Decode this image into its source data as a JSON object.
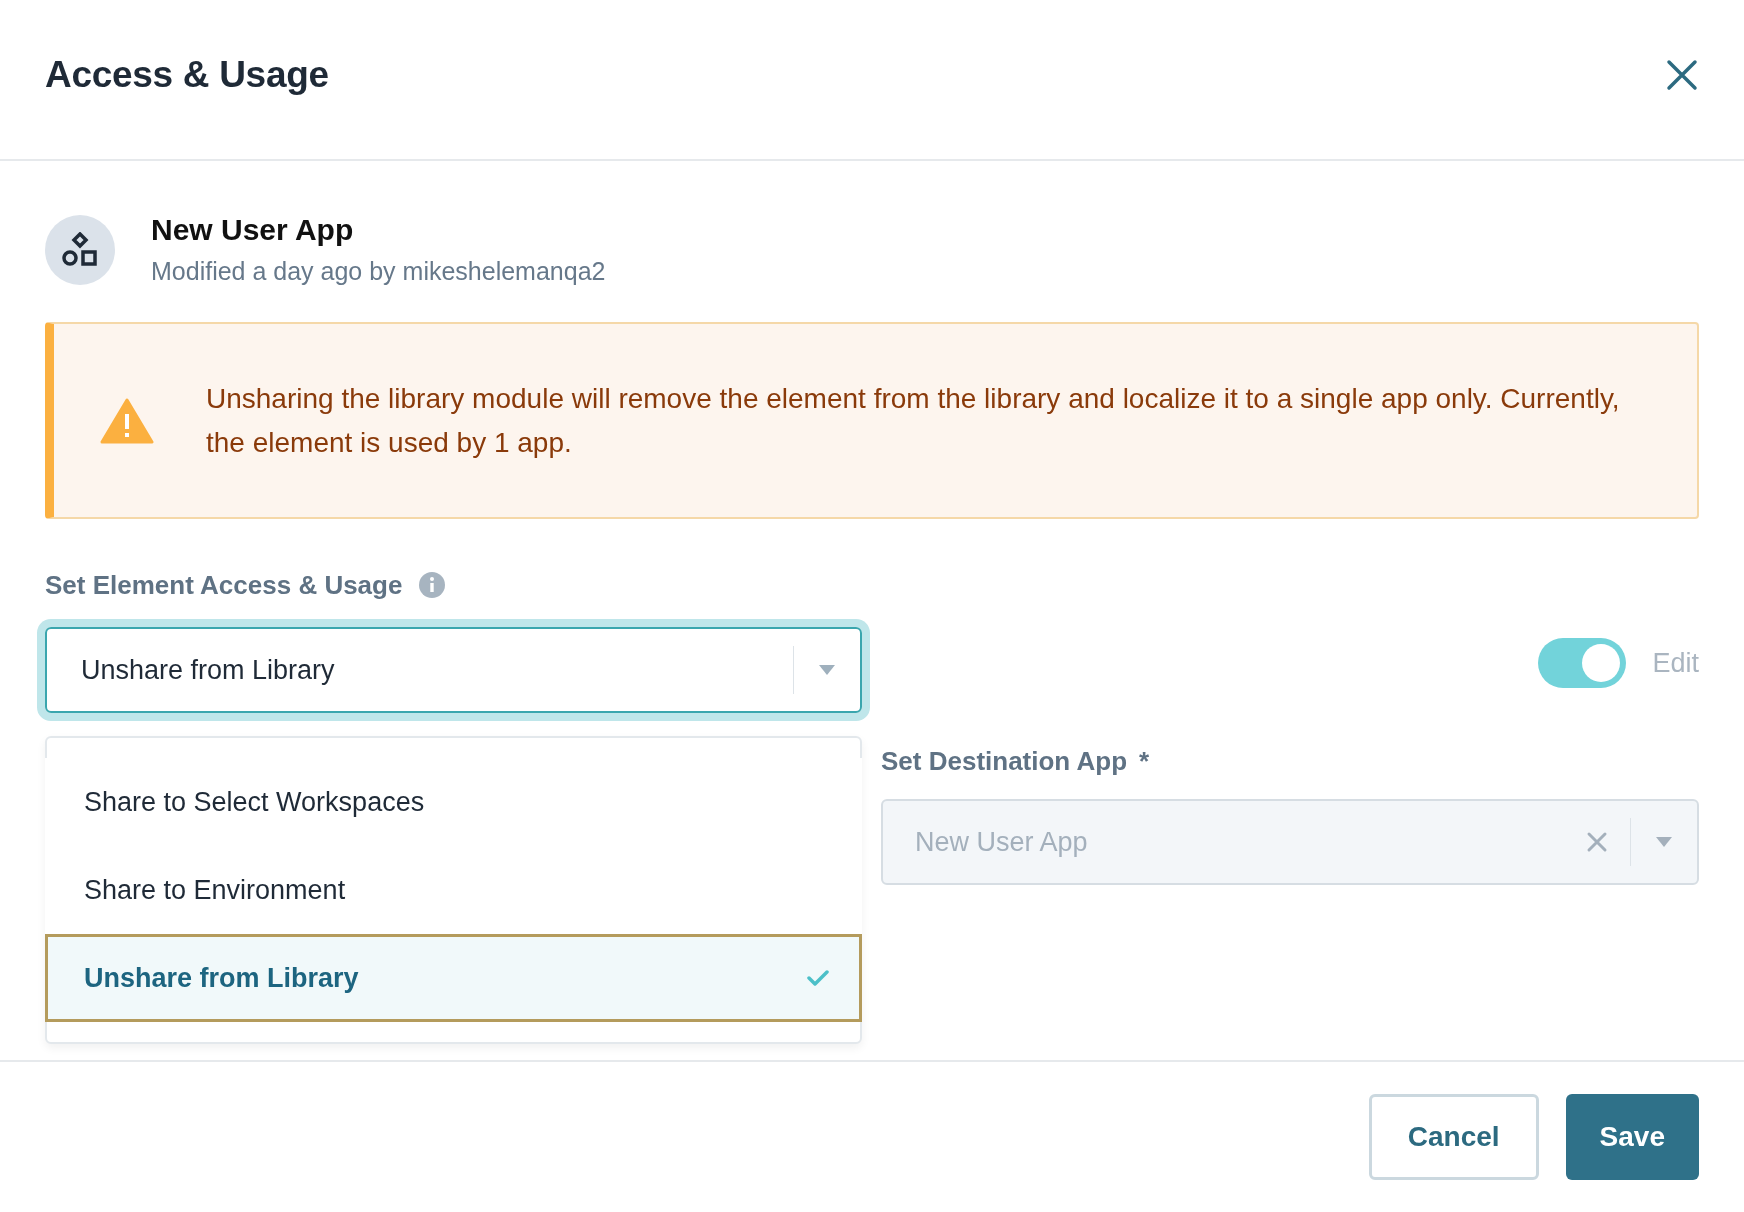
{
  "dialog": {
    "title": "Access & Usage"
  },
  "app": {
    "name": "New User App",
    "modified": "Modified a day ago by mikeshelemanqa2"
  },
  "warning": {
    "text": "Unsharing the library module will remove the element from the library and localize it to a single app only. Currently, the element is used by 1 app."
  },
  "access": {
    "label": "Set Element Access & Usage",
    "value": "Unshare from Library",
    "expanded": true,
    "options": [
      {
        "label": "Share to Select Workspaces",
        "selected": false
      },
      {
        "label": "Share to Environment",
        "selected": false
      },
      {
        "label": "Unshare from Library",
        "selected": true
      }
    ]
  },
  "edit_toggle": {
    "label": "Edit",
    "on": true
  },
  "destination": {
    "label": "Set Destination App",
    "required_mark": "*",
    "value": "New User App",
    "disabled": true
  },
  "buttons": [
    {
      "label": "Cancel",
      "kind": "secondary"
    },
    {
      "label": "Save",
      "kind": "primary"
    }
  ]
}
